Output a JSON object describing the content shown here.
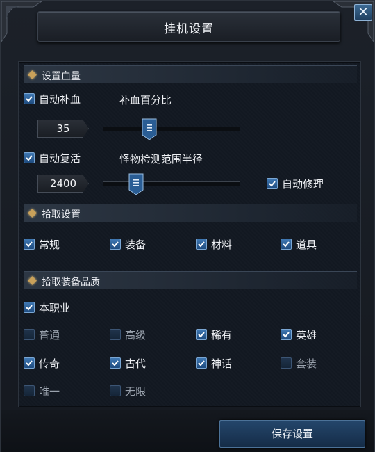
{
  "window": {
    "title": "挂机设置",
    "close_symbol": "✕"
  },
  "sections": {
    "hp": {
      "label": "设置血量"
    },
    "pickup": {
      "label": "拾取设置"
    },
    "quality": {
      "label": "拾取装备品质"
    }
  },
  "hp": {
    "auto_heal": {
      "label": "自动补血",
      "checked": true
    },
    "heal_percent_label": "补血百分比",
    "heal_percent_value": "35",
    "heal_percent_fraction": 0.34,
    "auto_revive": {
      "label": "自动复活",
      "checked": true
    },
    "detect_radius_label": "怪物检测范围半径",
    "detect_radius_value": "2400",
    "detect_radius_fraction": 0.24,
    "auto_repair": {
      "label": "自动修理",
      "checked": true
    }
  },
  "pickup": {
    "items": [
      {
        "label": "常规",
        "checked": true
      },
      {
        "label": "装备",
        "checked": true
      },
      {
        "label": "材料",
        "checked": true
      },
      {
        "label": "道具",
        "checked": true
      }
    ]
  },
  "quality": {
    "own_class": {
      "label": "本职业",
      "checked": true
    },
    "items": [
      {
        "label": "普通",
        "checked": false
      },
      {
        "label": "高级",
        "checked": false
      },
      {
        "label": "稀有",
        "checked": true
      },
      {
        "label": "英雄",
        "checked": true
      },
      {
        "label": "传奇",
        "checked": true
      },
      {
        "label": "古代",
        "checked": true
      },
      {
        "label": "神话",
        "checked": true
      },
      {
        "label": "套装",
        "checked": false
      },
      {
        "label": "唯一",
        "checked": false
      },
      {
        "label": "无限",
        "checked": false
      }
    ]
  },
  "footer": {
    "save_label": "保存设置"
  },
  "colors": {
    "accent": "#3f78b3",
    "diamond": "#c9a15a",
    "panel": "#121821"
  }
}
